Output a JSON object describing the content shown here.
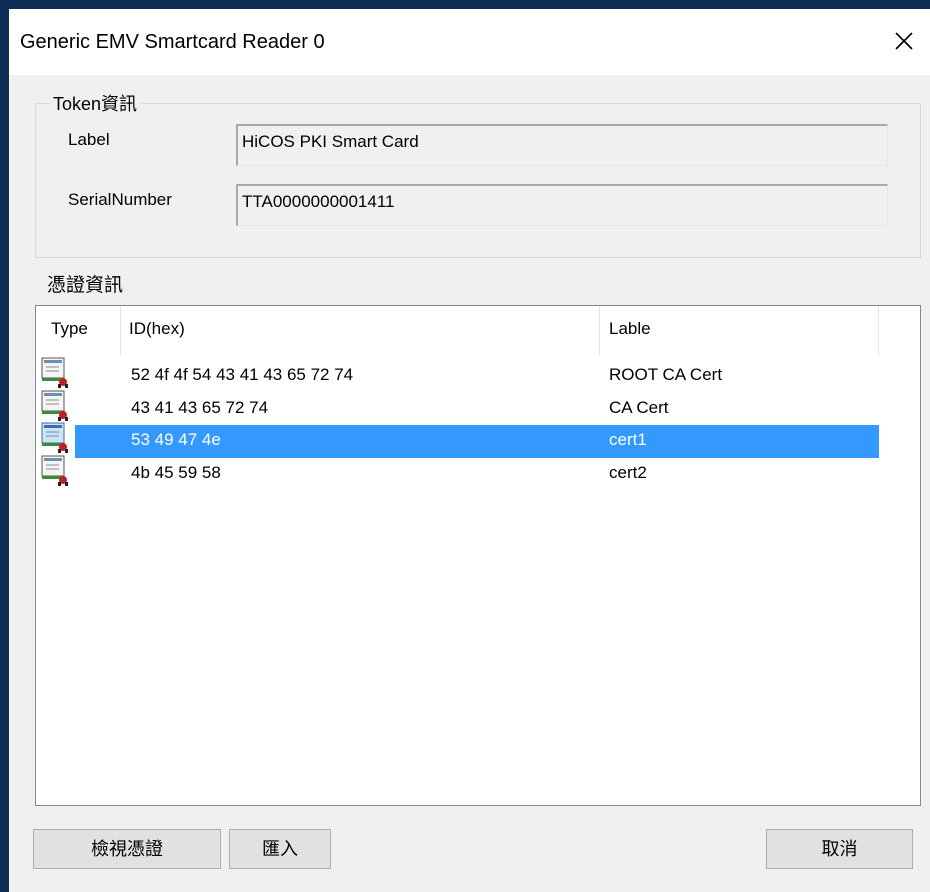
{
  "window": {
    "title": "Generic EMV Smartcard Reader 0"
  },
  "token_group": {
    "legend": "Token資訊",
    "label_caption": "Label",
    "label_value": "HiCOS PKI Smart Card",
    "serial_caption": "SerialNumber",
    "serial_value": "TTA0000000001411"
  },
  "cert_section": {
    "title": "憑證資訊",
    "columns": {
      "type": "Type",
      "id": "ID(hex)",
      "label": "Lable"
    },
    "rows": [
      {
        "icon": "certificate-icon",
        "id": "52 4f 4f 54 43 41 43 65 72 74",
        "label": "ROOT CA Cert"
      },
      {
        "icon": "certificate-icon",
        "id": "43 41 43 65 72 74",
        "label": "CA Cert"
      },
      {
        "icon": "certificate-icon",
        "id": "53 49 47 4e",
        "label": "cert1",
        "selected": true
      },
      {
        "icon": "certificate-icon",
        "id": "4b 45 59 58",
        "label": "cert2"
      }
    ],
    "selection_color": "#3399ff"
  },
  "buttons": {
    "view_cert": "檢視憑證",
    "import": "匯入",
    "cancel": "取消"
  }
}
